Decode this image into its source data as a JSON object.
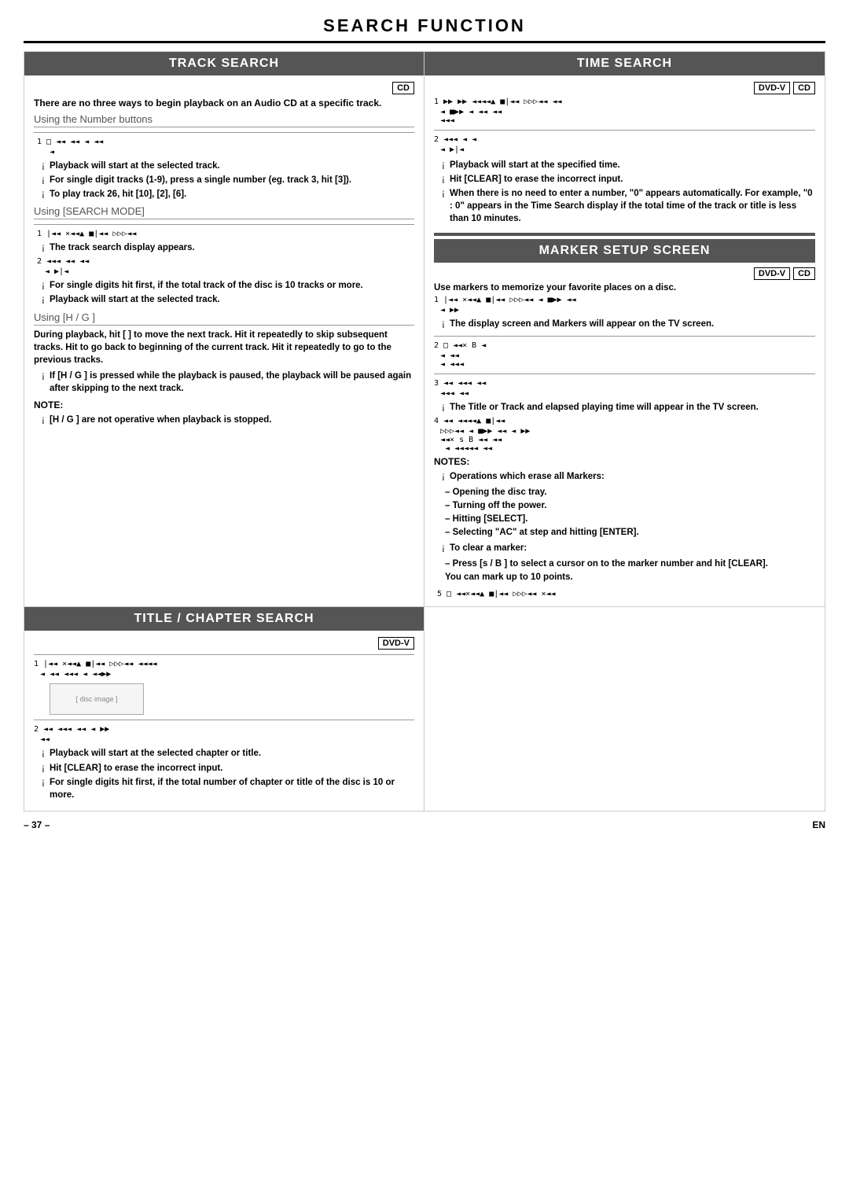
{
  "page": {
    "title": "SEARCH FUNCTION",
    "footer_page": "– 37 –",
    "footer_lang": "EN"
  },
  "track_search": {
    "header": "TRACK SEARCH",
    "badge": "CD",
    "intro": "There are no three ways to begin playback on an Audio CD at a specific track.",
    "using_number": "Using the Number buttons",
    "step1_icons": "1  □ ◄◄ ◄◄  ◄    ◄◄",
    "step1_indent": "◄",
    "bullets1": [
      "Playback will start at the selected track.",
      "For single digit tracks (1-9), press a single number (eg. track 3, hit [3]).",
      "To play track 26, hit [10], [2], [6]."
    ],
    "using_search": "Using [SEARCH MODE]",
    "search_icons": "1  |◄◄ ×◄◄▲ ■|◄◄ ▷▷▷◄◄",
    "search_bullet": "The track search display appears.",
    "step2_icons": "2   ◄◄◄  ◄◄   ◄◄",
    "step2_indent": "  ◄ ▶|◄",
    "bullets2": [
      "For single digits hit first, if the total track of the disc is 10 tracks or more.",
      "Playback will start at the selected track."
    ],
    "using_hg": "Using [H  /  G  ]",
    "hg_text1": "During playback, hit [  ] to move the next track. Hit it repeatedly to skip subsequent tracks. Hit to go back to beginning of the current track. Hit it repeatedly to go to the previous tracks.",
    "hg_bullet1": "If [H  / G  ] is pressed while the playback is paused, the playback will be paused again after skipping to the next track.",
    "note_label": "NOTE:",
    "note_bullet": "[H  / G  ] are not operative when playback is stopped."
  },
  "time_search": {
    "header": "TIME SEARCH",
    "badges": [
      "DVD-V",
      "CD"
    ],
    "step1_icons": "1  ▶▶  ▶▶   ◄◄◄◄▲ ■|◄◄ ▷▷▷◄◄ ◄◄",
    "step1_line2": "  ◄ ■▶▶  ◄   ◄◄  ◄◄",
    "step1_line3": "  ◄◄◄",
    "step2_icons": "2   ◄◄◄   ◄    ◄",
    "step2_line2": "  ◄ ▶|◄",
    "bullets": [
      "Playback will start at the specified time.",
      "Hit [CLEAR] to erase the incorrect input.",
      "When there is no need to enter a number, \"0\" appears automatically. For example, \"0 : 0\" appears in the Time Search display if the total time of the track or title is less than 10 minutes."
    ]
  },
  "marker_setup": {
    "header": "MARKER SETUP SCREEN",
    "badges": [
      "DVD-V",
      "CD"
    ],
    "intro": "Use markers to memorize your favorite places on a disc.",
    "step1_icons": "1  |◄◄ ×◄◄▲ ■|◄◄ ▷▷▷◄◄  ◄ ■▶▶  ◄◄",
    "step1_line2": "  ◄  ▶▶",
    "step1_bullet": "The display screen and Markers will appear on the TV screen.",
    "step2_icons": "2  □ ◄◄×  B  ◄",
    "step2_line2": "  ◄  ◄◄",
    "step2_line3": "  ◄  ◄◄◄",
    "step3_icons": "3   ◄◄  ◄◄◄   ◄◄",
    "step3_line2": "  ◄◄◄ ◄◄",
    "step3_bullet": "The Title or Track and elapsed playing time will appear in the TV screen.",
    "step4_icons": "4   ◄◄  ◄◄◄◄▲ ■|◄◄",
    "step4_line2": "  ▷▷▷◄◄  ◄ ■▶▶  ◄◄ ◄  ▶▶",
    "step4_line3": "  ◄◄× s  B  ◄◄ ◄◄",
    "step4_indent": "◄   ◄◄◄◄◄ ◄◄",
    "notes_label": "NOTES:",
    "notes_bullets": [
      "Operations which erase all Markers:",
      "– Opening the disc tray.",
      "– Turning off the power.",
      "– Hitting [SELECT].",
      "– Selecting \"AC\" at step and hitting [ENTER]."
    ],
    "clear_bullet": "To clear a marker:",
    "clear_sub": [
      "– Press [s / B ] to select a cursor on to the marker number and hit [CLEAR].",
      "You can mark up to 10 points."
    ],
    "step5_icons": "5  □ ◄◄×◄◄▲ ■|◄◄ ▷▷▷◄◄  ×◄◄"
  },
  "title_chapter": {
    "header": "TITLE / CHAPTER SEARCH",
    "badge": "DVD-V",
    "step1_icons": "1  |◄◄ ×◄◄▲ ■|◄◄ ▷▷▷◄◄    ◄◄◄◄",
    "step1_line2": "  ◄  ◄◄  ◄◄◄ ◄  ◄◄▶▶",
    "step2_icons": "2   ◄◄   ◄◄◄   ◄◄  ◄ ▶▶",
    "step2_line2": "  ◄◄",
    "bullets": [
      "Playback will start at the selected chapter or title.",
      "Hit [CLEAR] to erase the incorrect input.",
      "For single digits hit first, if the total number of chapter or title of the disc is 10 or more."
    ]
  }
}
